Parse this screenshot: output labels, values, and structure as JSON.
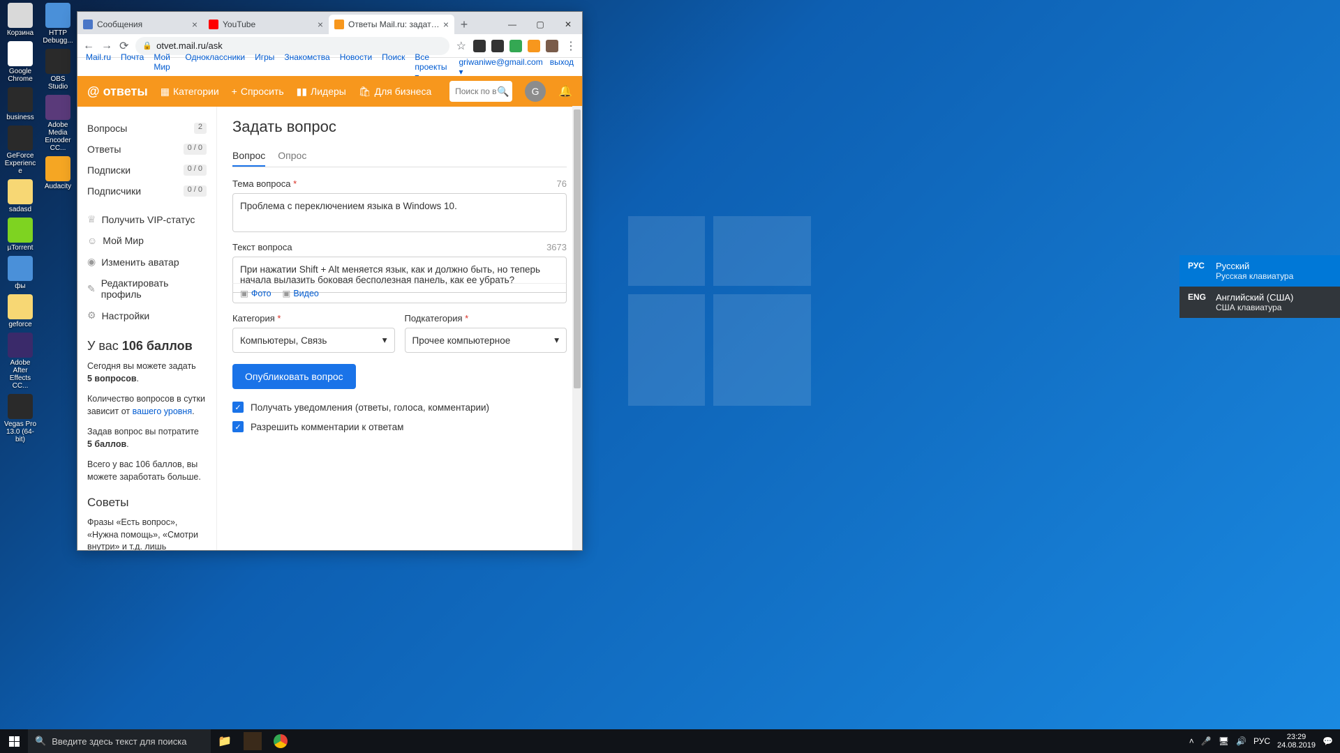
{
  "desktop_icons_col1": [
    {
      "label": "Корзина",
      "color": "#d9d9d9"
    },
    {
      "label": "Google Chrome",
      "color": "#fff"
    },
    {
      "label": "business",
      "color": "#2a2a2a"
    },
    {
      "label": "GeForce Experience",
      "color": "#2a2a2a"
    },
    {
      "label": "sadasd",
      "color": "#f7d774"
    },
    {
      "label": "µTorrent",
      "color": "#7ed321"
    },
    {
      "label": "фы",
      "color": "#4a90d9"
    },
    {
      "label": "geforce",
      "color": "#f7d774"
    },
    {
      "label": "Adobe After Effects CC...",
      "color": "#3a2a6a"
    },
    {
      "label": "Vegas Pro 13.0 (64-bit)",
      "color": "#2a2a2a"
    }
  ],
  "desktop_icons_col2": [
    {
      "label": "HTTP Debugg...",
      "color": "#4a90d9"
    },
    {
      "label": "OBS Studio",
      "color": "#2a2a2a"
    },
    {
      "label": "Adobe Media Encoder CC...",
      "color": "#5a3a7a"
    },
    {
      "label": "Audacity",
      "color": "#f5a623"
    }
  ],
  "browser": {
    "tabs": [
      {
        "title": "Сообщения",
        "favicon": "#4a76c7"
      },
      {
        "title": "YouTube",
        "favicon": "#ff0000"
      },
      {
        "title": "Ответы Mail.ru: задать вопрос",
        "favicon": "#f7971d",
        "active": true
      }
    ],
    "url": "otvet.mail.ru/ask",
    "extensions_colors": [
      "#333",
      "#333",
      "#34a853",
      "#f7971d",
      "#7a5c4a"
    ]
  },
  "mailru_nav": {
    "links": [
      "Mail.ru",
      "Почта",
      "Мой Мир",
      "Одноклассники",
      "Игры",
      "Знакомства",
      "Новости",
      "Поиск",
      "Все проекты ▾"
    ],
    "user": "griwaniwe@gmail.com ▾",
    "exit": "выход"
  },
  "header": {
    "logo": "ответы",
    "items": [
      {
        "icon": "▦",
        "label": "Категории"
      },
      {
        "icon": "+",
        "label": "Спросить"
      },
      {
        "icon": "▮▮",
        "label": "Лидеры"
      },
      {
        "icon": "🛍",
        "label": "Для бизнеса"
      }
    ],
    "search_placeholder": "Поиск по в",
    "avatar_letter": "G"
  },
  "sidebar": {
    "stats": [
      {
        "label": "Вопросы",
        "badge": "2"
      },
      {
        "label": "Ответы",
        "badge": "0 / 0"
      },
      {
        "label": "Подписки",
        "badge": "0 / 0"
      },
      {
        "label": "Подписчики",
        "badge": "0 / 0"
      }
    ],
    "links": [
      {
        "icon": "♕",
        "label": "Получить VIP-статус"
      },
      {
        "icon": "☺",
        "label": "Мой Мир"
      },
      {
        "icon": "◉",
        "label": "Изменить аватар"
      },
      {
        "icon": "✎",
        "label": "Редактировать профиль"
      },
      {
        "icon": "⚙",
        "label": "Настройки"
      }
    ],
    "points_title": "У вас 106 баллов",
    "today_text": "Сегодня вы можете задать",
    "today_bold": "5 вопросов",
    "quota_text": "Количество вопросов в сутки зависит от ",
    "quota_link": "вашего уровня",
    "ask_cost": "Задав вопрос вы потратите",
    "ask_cost_bold": "5 баллов",
    "total_text": "Всего у вас 106 баллов, вы можете заработать больше.",
    "tips_title": "Советы",
    "tips_text": "Фразы «Есть вопрос», «Нужна помощь», «Смотри внутри» и т.д. лишь занимают полезное место."
  },
  "main": {
    "title": "Задать вопрос",
    "tab1": "Вопрос",
    "tab2": "Опрос",
    "topic_label": "Тема вопроса",
    "topic_count": "76",
    "topic_value": "Проблема с переключением языка в Windows 10.",
    "text_label": "Текст вопроса",
    "text_count": "3673",
    "text_value": "При нажатии Shift + Alt меняется язык, как и должно быть, но теперь начала вылазить боковая бесполезная панель, как ее убрать?",
    "attach_photo": "Фото",
    "attach_video": "Видео",
    "category_label": "Категория",
    "subcategory_label": "Подкатегория",
    "category_value": "Компьютеры, Связь",
    "subcategory_value": "Прочее компьютерное",
    "publish": "Опубликовать вопрос",
    "chk1": "Получать уведомления (ответы, голоса, комментарии)",
    "chk2": "Разрешить комментарии к ответам"
  },
  "lang_popup": {
    "options": [
      {
        "code": "РУС",
        "name": "Русский",
        "sub": "Русская клавиатура",
        "active": true
      },
      {
        "code": "ENG",
        "name": "Английский (США)",
        "sub": "США клавиатура",
        "active": false
      }
    ]
  },
  "taskbar": {
    "search_placeholder": "Введите здесь текст для поиска",
    "lang": "РУС",
    "time": "23:29",
    "date": "24.08.2019"
  }
}
